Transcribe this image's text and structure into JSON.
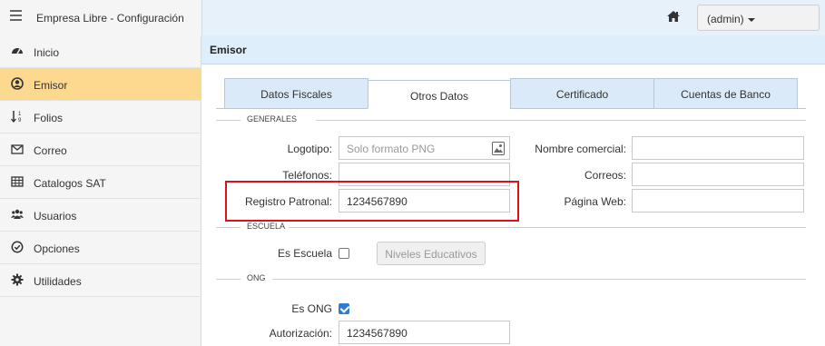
{
  "app": {
    "title": "Empresa Libre - Configuración",
    "user_label": "(admin)"
  },
  "icons": {
    "menu": "hamburger-icon",
    "home": "home-icon",
    "user_caret": "caret-down-icon"
  },
  "sidebar": {
    "items": [
      {
        "label": "Inicio",
        "icon": "dashboard-icon"
      },
      {
        "label": "Emisor",
        "icon": "user-circle-icon",
        "active": true
      },
      {
        "label": "Folios",
        "icon": "sort-numeric-icon"
      },
      {
        "label": "Correo",
        "icon": "envelope-icon"
      },
      {
        "label": "Catalogos SAT",
        "icon": "table-icon"
      },
      {
        "label": "Usuarios",
        "icon": "users-icon"
      },
      {
        "label": "Opciones",
        "icon": "check-circle-icon"
      },
      {
        "label": "Utilidades",
        "icon": "cog-icon"
      }
    ],
    "active_color": "#fcd98f"
  },
  "panel": {
    "title": "Emisor"
  },
  "tabs": [
    {
      "label": "Datos Fiscales"
    },
    {
      "label": "Otros Datos",
      "active": true
    },
    {
      "label": "Certificado"
    },
    {
      "label": "Cuentas de Banco"
    }
  ],
  "generales": {
    "title": "GENERALES",
    "logotipo_label": "Logotipo:",
    "logotipo_placeholder": "Solo formato PNG",
    "telefonos_label": "Teléfonos:",
    "telefonos_value": "",
    "registro_label": "Registro Patronal:",
    "registro_value": "1234567890",
    "nombre_comercial_label": "Nombre comercial:",
    "nombre_comercial_value": "",
    "correos_label": "Correos:",
    "correos_value": "",
    "pagina_web_label": "Página Web:",
    "pagina_web_value": ""
  },
  "escuela": {
    "title": "ESCUELA",
    "es_escuela_label": "Es Escuela",
    "es_escuela_checked": false,
    "niveles_button": "Niveles Educativos"
  },
  "ong": {
    "title": "ONG",
    "es_ong_label": "Es ONG",
    "es_ong_checked": true,
    "autorizacion_label": "Autorización:",
    "autorizacion_value": "1234567890"
  },
  "colors": {
    "highlight": "#d9121b",
    "header_bg": "#dfeefb",
    "tab_bg": "#dbeaf8",
    "checkbox_on": "#2d7dd2"
  }
}
